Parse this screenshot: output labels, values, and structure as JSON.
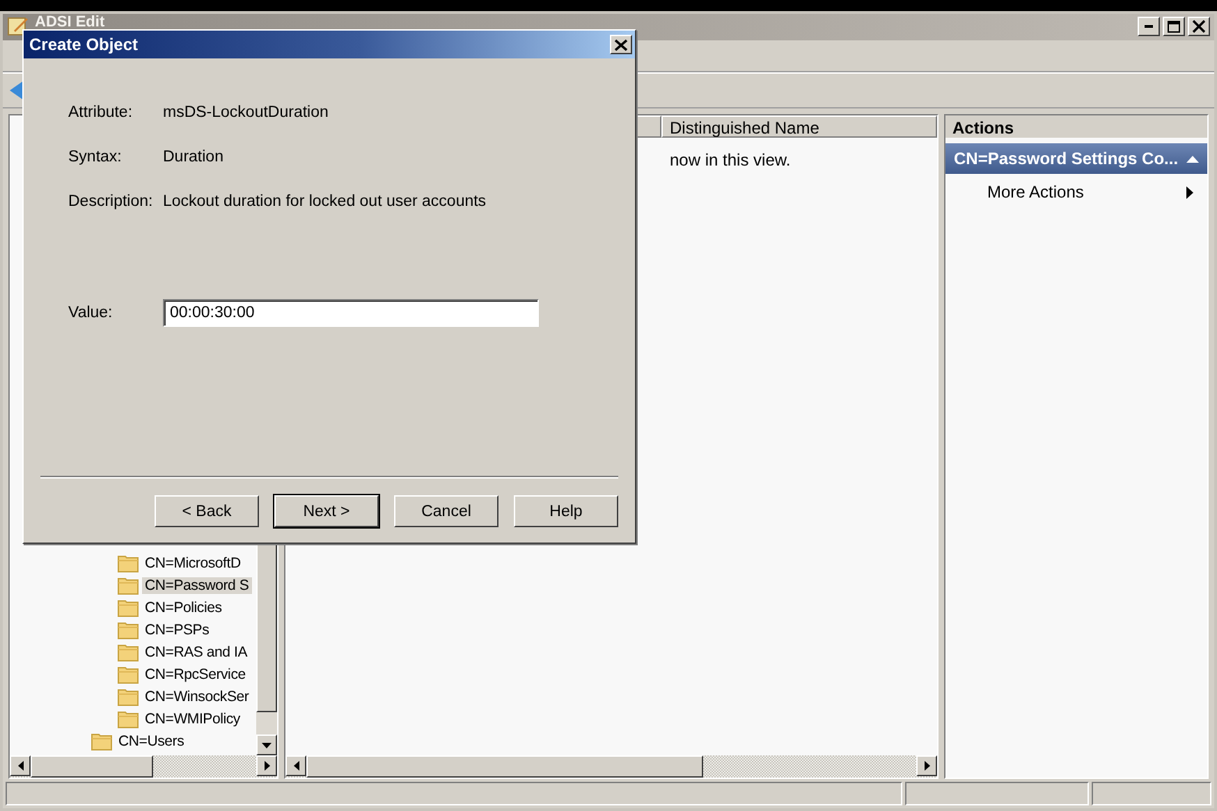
{
  "window": {
    "title": "ADSI Edit"
  },
  "tree": {
    "items": [
      {
        "children": [
          {
            "label": "CN=MicrosoftD",
            "selected": false
          },
          {
            "label": "CN=Password S",
            "selected": true
          },
          {
            "label": "CN=Policies",
            "selected": false
          },
          {
            "label": "CN=PSPs",
            "selected": false
          },
          {
            "label": "CN=RAS and IA",
            "selected": false
          },
          {
            "label": "CN=RpcService",
            "selected": false
          },
          {
            "label": "CN=WinsockSer",
            "selected": false
          },
          {
            "label": "CN=WMIPolicy",
            "selected": false
          }
        ]
      },
      {
        "label": "CN=Users",
        "selected": false
      }
    ]
  },
  "list": {
    "columns": [
      "Distinguished Name"
    ],
    "empty_message": "now in this view."
  },
  "actions": {
    "title": "Actions",
    "section": {
      "title": "CN=Password Settings Co...",
      "expanded": true
    },
    "items": [
      {
        "label": "More Actions"
      }
    ]
  },
  "dialog": {
    "title": "Create Object",
    "fields": [
      {
        "label": "Attribute:",
        "value": "msDS-LockoutDuration"
      },
      {
        "label": "Syntax:",
        "value": "Duration"
      },
      {
        "label": "Description:",
        "value": "Lockout duration for locked out user accounts"
      }
    ],
    "input": {
      "label": "Value:",
      "value": "00:00:30:00"
    },
    "buttons": [
      {
        "label": "< Back",
        "default": false
      },
      {
        "label": "Next >",
        "default": true
      },
      {
        "label": "Cancel",
        "default": false
      },
      {
        "label": "Help",
        "default": false
      }
    ]
  }
}
